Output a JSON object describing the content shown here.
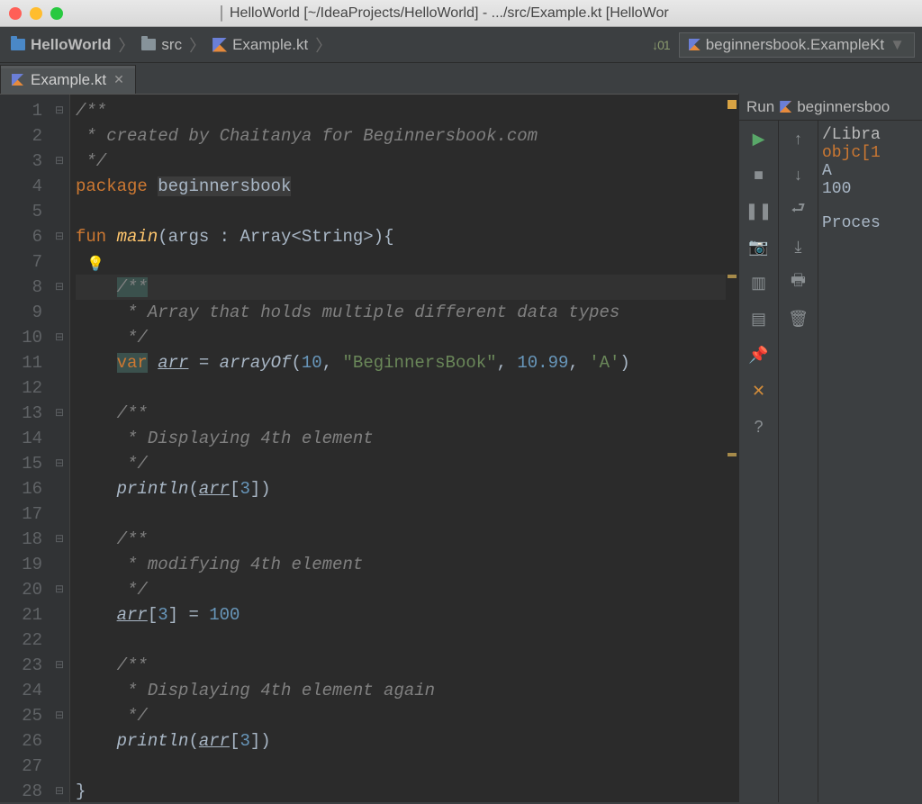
{
  "window": {
    "title": "HelloWorld [~/IdeaProjects/HelloWorld] - .../src/Example.kt [HelloWor"
  },
  "breadcrumbs": {
    "project": "HelloWorld",
    "folder": "src",
    "file": "Example.kt"
  },
  "run_config": {
    "label": "beginnersbook.ExampleKt"
  },
  "tab": {
    "filename": "Example.kt"
  },
  "editor": {
    "lines": [
      {
        "n": 1,
        "fold": "⊟",
        "segs": [
          {
            "t": "/**",
            "c": "c-comment"
          }
        ]
      },
      {
        "n": 2,
        "segs": [
          {
            "t": " * created by Chaitanya for Beginnersbook.com",
            "c": "c-comment"
          }
        ]
      },
      {
        "n": 3,
        "fold": "⊟",
        "segs": [
          {
            "t": " */",
            "c": "c-comment"
          }
        ]
      },
      {
        "n": 4,
        "segs": [
          {
            "t": "package",
            "c": "c-kw"
          },
          {
            "t": " "
          },
          {
            "t": "beginnersbook",
            "c": "c-pkg"
          }
        ]
      },
      {
        "n": 5,
        "segs": []
      },
      {
        "n": 6,
        "run": true,
        "fold": "⊟",
        "segs": [
          {
            "t": "fun",
            "c": "c-kw"
          },
          {
            "t": " "
          },
          {
            "t": "main",
            "c": "c-fn"
          },
          {
            "t": "(args : Array<String>){"
          }
        ]
      },
      {
        "n": 7,
        "segs": []
      },
      {
        "n": 8,
        "fold": "⊟",
        "cur": true,
        "segs": [
          {
            "t": "    "
          },
          {
            "t": "/**",
            "c": "c-comment c-hl"
          }
        ]
      },
      {
        "n": 9,
        "segs": [
          {
            "t": "     * Array that holds multiple different data types",
            "c": "c-comment"
          }
        ]
      },
      {
        "n": 10,
        "fold": "⊟",
        "segs": [
          {
            "t": "     */",
            "c": "c-comment"
          }
        ]
      },
      {
        "n": 11,
        "segs": [
          {
            "t": "    "
          },
          {
            "t": "var",
            "c": "c-kw c-hl"
          },
          {
            "t": " "
          },
          {
            "t": "arr",
            "c": "c-id c-ul"
          },
          {
            "t": " = "
          },
          {
            "t": "arrayOf",
            "c": "c-id"
          },
          {
            "t": "("
          },
          {
            "t": "10",
            "c": "c-num"
          },
          {
            "t": ", "
          },
          {
            "t": "\"BeginnersBook\"",
            "c": "c-str"
          },
          {
            "t": ", "
          },
          {
            "t": "10.99",
            "c": "c-num"
          },
          {
            "t": ", "
          },
          {
            "t": "'A'",
            "c": "c-str"
          },
          {
            "t": ")"
          }
        ]
      },
      {
        "n": 12,
        "segs": []
      },
      {
        "n": 13,
        "fold": "⊟",
        "segs": [
          {
            "t": "    /**",
            "c": "c-comment"
          }
        ]
      },
      {
        "n": 14,
        "segs": [
          {
            "t": "     * Displaying 4th element",
            "c": "c-comment"
          }
        ]
      },
      {
        "n": 15,
        "fold": "⊟",
        "segs": [
          {
            "t": "     */",
            "c": "c-comment"
          }
        ]
      },
      {
        "n": 16,
        "segs": [
          {
            "t": "    "
          },
          {
            "t": "println",
            "c": "c-id"
          },
          {
            "t": "("
          },
          {
            "t": "arr",
            "c": "c-id c-ul"
          },
          {
            "t": "["
          },
          {
            "t": "3",
            "c": "c-num"
          },
          {
            "t": "])"
          }
        ]
      },
      {
        "n": 17,
        "segs": []
      },
      {
        "n": 18,
        "fold": "⊟",
        "segs": [
          {
            "t": "    /**",
            "c": "c-comment"
          }
        ]
      },
      {
        "n": 19,
        "segs": [
          {
            "t": "     * modifying 4th element",
            "c": "c-comment"
          }
        ]
      },
      {
        "n": 20,
        "fold": "⊟",
        "segs": [
          {
            "t": "     */",
            "c": "c-comment"
          }
        ]
      },
      {
        "n": 21,
        "segs": [
          {
            "t": "    "
          },
          {
            "t": "arr",
            "c": "c-id c-ul"
          },
          {
            "t": "["
          },
          {
            "t": "3",
            "c": "c-num"
          },
          {
            "t": "] = "
          },
          {
            "t": "100",
            "c": "c-num"
          }
        ]
      },
      {
        "n": 22,
        "segs": []
      },
      {
        "n": 23,
        "fold": "⊟",
        "segs": [
          {
            "t": "    /**",
            "c": "c-comment"
          }
        ]
      },
      {
        "n": 24,
        "segs": [
          {
            "t": "     * Displaying 4th element again",
            "c": "c-comment"
          }
        ]
      },
      {
        "n": 25,
        "fold": "⊟",
        "segs": [
          {
            "t": "     */",
            "c": "c-comment"
          }
        ]
      },
      {
        "n": 26,
        "segs": [
          {
            "t": "    "
          },
          {
            "t": "println",
            "c": "c-id"
          },
          {
            "t": "("
          },
          {
            "t": "arr",
            "c": "c-id c-ul"
          },
          {
            "t": "["
          },
          {
            "t": "3",
            "c": "c-num"
          },
          {
            "t": "])"
          }
        ]
      },
      {
        "n": 27,
        "segs": []
      },
      {
        "n": 28,
        "fold": "⊟",
        "segs": [
          {
            "t": "}"
          }
        ]
      }
    ]
  },
  "run_panel": {
    "title_prefix": "Run",
    "config": "beginnersboo",
    "output": {
      "path": "/Libra",
      "warn": "objc[1",
      "line1": "A",
      "line2": "100",
      "exit": "Proces"
    }
  },
  "icons": {
    "sort": "↓01",
    "dropdown": "▼",
    "close_tab": "✕",
    "bulb": "💡",
    "play": "▶",
    "up": "↑",
    "stop": "■",
    "down": "↓",
    "pause": "❚❚",
    "wrap": "⮐",
    "camera": "📷",
    "scroll": "⤓",
    "layout": "▥",
    "print": "🖶",
    "dump": "▤",
    "trash": "🗑",
    "pin": "📌",
    "x": "✕",
    "help": "?"
  }
}
